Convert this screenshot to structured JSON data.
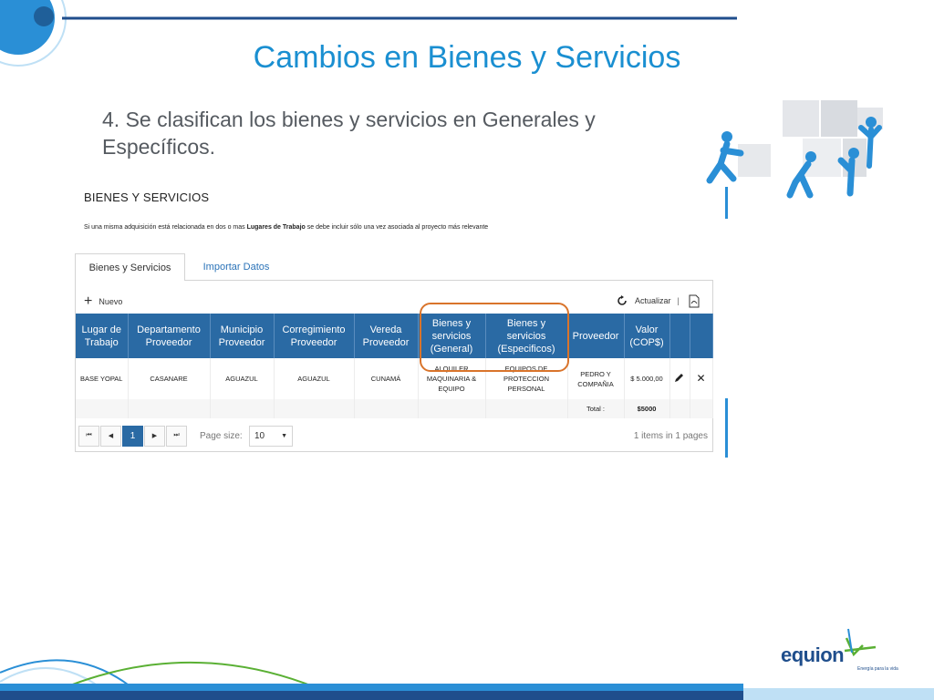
{
  "slide": {
    "title": "Cambios en Bienes y Servicios",
    "bullet": "4. Se clasifican los bienes y servicios en Generales y Específicos."
  },
  "app": {
    "section_title": "BIENES Y SERVICIOS",
    "note_prefix": "Si una misma adquisición está relacionada en dos o mas ",
    "note_bold": "Lugares de Trabajo",
    "note_suffix": " se debe incluir sólo una vez asociada al proyecto más relevante",
    "tabs": [
      {
        "label": "Bienes y Servicios",
        "active": true
      },
      {
        "label": "Importar Datos",
        "active": false
      }
    ],
    "toolbar": {
      "new_label": "Nuevo",
      "refresh_label": "Actualizar"
    },
    "columns": [
      "Lugar de Trabajo",
      "Departamento Proveedor",
      "Municipio Proveedor",
      "Corregimiento Proveedor",
      "Vereda Proveedor",
      "Bienes y servicios (General)",
      "Bienes y servicios (Especificos)",
      "Proveedor",
      "Valor (COP$)"
    ],
    "rows": [
      {
        "lugar": "BASE YOPAL",
        "departamento": "CASANARE",
        "municipio": "AGUAZUL",
        "corregimiento": "AGUAZUL",
        "vereda": "CUNAMÁ",
        "general": "ALQUILER MAQUINARIA & EQUIPO",
        "especifico": "EQUIPOS DE PROTECCION PERSONAL",
        "proveedor": "PEDRO Y COMPAÑIA",
        "valor": "$ 5.000,00"
      }
    ],
    "total_label": "Total :",
    "total_value": "$5000",
    "pager": {
      "current_page": "1",
      "page_size_label": "Page size:",
      "page_size": "10",
      "items_info": "1 items in 1 pages"
    }
  },
  "brand": {
    "logo": "equion",
    "tagline": "Energía para la vida"
  },
  "colors": {
    "title_blue": "#1a8fd1",
    "header_blue": "#2a6aa4",
    "highlight_orange": "#d9742b",
    "accent_green": "#5ab034"
  }
}
